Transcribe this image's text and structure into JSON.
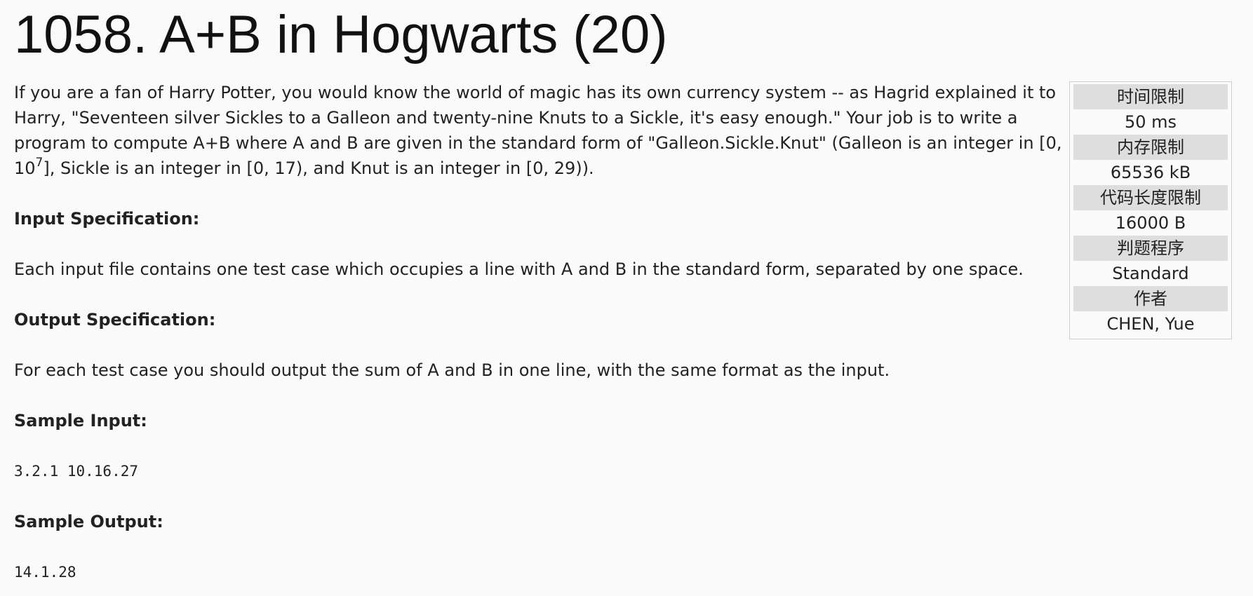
{
  "problem": {
    "title": "1058. A+B in Hogwarts (20)",
    "intro_part1": "If you are a fan of Harry Potter, you would know the world of magic has its own currency system -- as Hagrid explained it to Harry, \"Seventeen silver Sickles to a Galleon and twenty-nine Knuts to a Sickle, it's easy enough.\" Your job is to write a program to compute A+B where A and B are given in the standard form of \"Galleon.Sickle.Knut\" (Galleon is an integer in [0, 10",
    "intro_sup": "7",
    "intro_part2": "], Sickle is an integer in [0, 17), and Knut is an integer in [0, 29)).",
    "input_heading": "Input Specification:",
    "input_text": "Each input file contains one test case which occupies a line with A and B in the standard form, separated by one space.",
    "output_heading": "Output Specification:",
    "output_text": "For each test case you should output the sum of A and B in one line, with the same format as the input.",
    "sample_input_heading": "Sample Input:",
    "sample_input": "3.2.1 10.16.27",
    "sample_output_heading": "Sample Output:",
    "sample_output": "14.1.28"
  },
  "info": {
    "items": [
      {
        "label": "时间限制",
        "value": "50 ms"
      },
      {
        "label": "内存限制",
        "value": "65536 kB"
      },
      {
        "label": "代码长度限制",
        "value": "16000 B"
      },
      {
        "label": "判题程序",
        "value": "Standard"
      },
      {
        "label": "作者",
        "value": "CHEN, Yue"
      }
    ]
  }
}
